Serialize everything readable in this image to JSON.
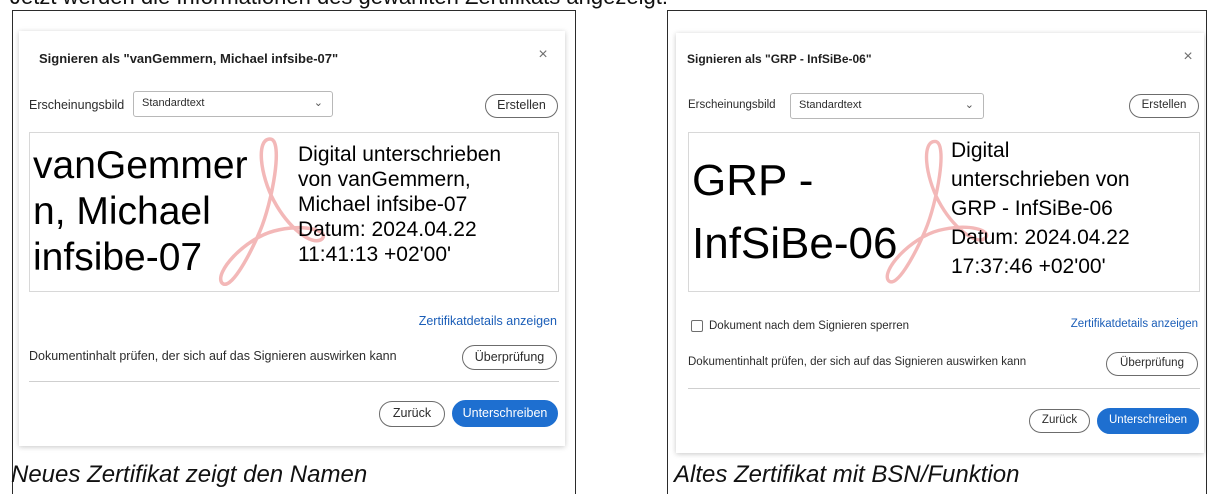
{
  "top_caption": "Jetzt werden die Informationen des gewählten Zertifikats angezeigt:",
  "left": {
    "dialog_title": "Signieren als \"vanGemmern, Michael infsibe-07\"",
    "close_glyph": "×",
    "appearance_label": "Erscheinungsbild",
    "appearance_value": "Standardtext",
    "create_button": "Erstellen",
    "preview": {
      "name_lines": [
        "vanGemmer",
        "n, Michael",
        "infsibe-07"
      ],
      "detail_lines": [
        "Digital unterschrieben",
        "von vanGemmern,",
        "Michael infsibe-07",
        "Datum: 2024.04.22",
        "11:41:13 +02'00'"
      ]
    },
    "certificate_details_link": "Zertifikatdetails anzeigen",
    "review_text": "Dokumentinhalt prüfen, der sich auf das Signieren auswirken kann",
    "review_button": "Überprüfung",
    "back_button": "Zurück",
    "sign_button": "Unterschreiben",
    "caption": "Neues Zertifikat zeigt den Namen"
  },
  "right": {
    "dialog_title": "Signieren als \"GRP - InfSiBe-06\"",
    "close_glyph": "×",
    "appearance_label": "Erscheinungsbild",
    "appearance_value": "Standardtext",
    "create_button": "Erstellen",
    "preview": {
      "name_lines": [
        "GRP -",
        "InfSiBe-06"
      ],
      "detail_lines": [
        "Digital",
        "unterschrieben von",
        "GRP - InfSiBe-06",
        "Datum: 2024.04.22",
        "17:37:46 +02'00'"
      ]
    },
    "lock_checkbox_label": "Dokument nach dem Signieren sperren",
    "lock_checked": false,
    "certificate_details_link": "Zertifikatdetails anzeigen",
    "review_text": "Dokumentinhalt prüfen, der sich auf das Signieren auswirken kann",
    "review_button": "Überprüfung",
    "back_button": "Zurück",
    "sign_button": "Unterschreiben",
    "caption": "Altes Zertifikat mit BSN/Funktion"
  },
  "colors": {
    "primary_button": "#1e6fd0",
    "link": "#1b5eb8",
    "acrobat_watermark": "#f3b8b8"
  },
  "icons": {
    "close": "close-icon",
    "dropdown": "chevron-down-icon",
    "watermark": "acrobat-logo-icon"
  }
}
